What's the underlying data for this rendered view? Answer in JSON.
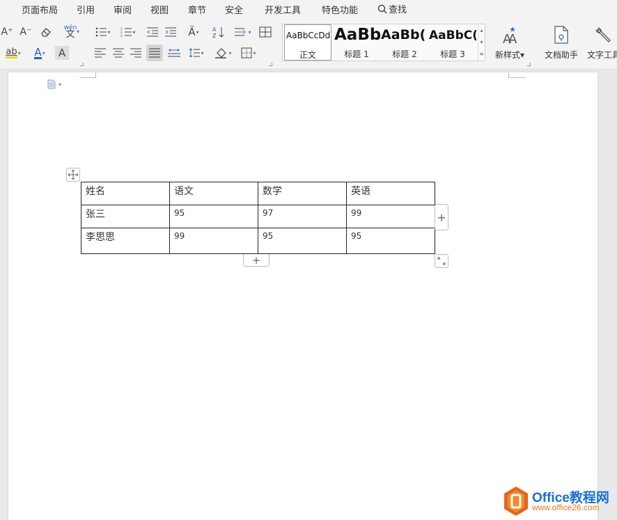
{
  "menu": {
    "items": [
      "页面布局",
      "引用",
      "审阅",
      "视图",
      "章节",
      "安全",
      "开发工具",
      "特色功能"
    ],
    "search_label": "查找"
  },
  "ribbon": {
    "font_buttons": {
      "grow": "A⁺",
      "shrink": "A⁻",
      "phonetic": "wén",
      "highlight": "ab",
      "font_color": "A",
      "char_shade": "A"
    },
    "styles": [
      {
        "preview": "AaBbCcDd",
        "label": "正文"
      },
      {
        "preview": "AaBb",
        "label": "标题 1"
      },
      {
        "preview": "AaBb(",
        "label": "标题 2"
      },
      {
        "preview": "AaBbC(",
        "label": "标题 3"
      }
    ],
    "new_style_label": "新样式",
    "doc_assistant_label": "文档助手",
    "text_tools_label": "文字工具"
  },
  "table": {
    "headers": [
      "姓名",
      "语文",
      "数学",
      "英语"
    ],
    "rows": [
      [
        "张三",
        "95",
        "97",
        "99"
      ],
      [
        "李思思",
        "99",
        "95",
        "95"
      ]
    ]
  },
  "table_controls": {
    "add_column": "+",
    "add_row": "+"
  },
  "watermark": {
    "brand": "Office教程网",
    "url": "www.office26.com"
  },
  "colors": {
    "highlight": "#f5d800",
    "font_color": "#1a5fd6",
    "brand_blue": "#1a6fd6",
    "brand_orange": "#e8641a"
  }
}
